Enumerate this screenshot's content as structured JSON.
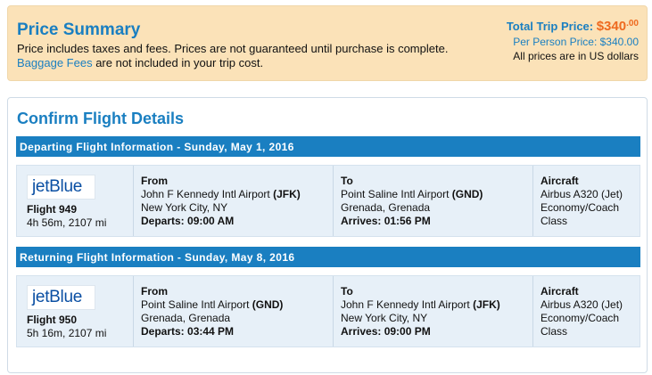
{
  "price_summary": {
    "title": "Price Summary",
    "note_line1": "Price includes taxes and fees. Prices are not guaranteed until purchase is complete.",
    "baggage_link": "Baggage Fees",
    "note_line2_rest": " are not included in your trip cost.",
    "total_label": "Total Trip Price: ",
    "total_dollars": "$340",
    "total_cents": ".00",
    "per_person": "Per Person Price: $340.00",
    "currency_note": "All prices are in US dollars"
  },
  "confirm": {
    "title": "Confirm Flight Details"
  },
  "departing": {
    "header": "Departing Flight Information - Sunday, May 1, 2016",
    "airline_logo_text": "jetBlue",
    "flight": "Flight 949",
    "duration": "4h 56m, 2107 mi",
    "from_head": "From",
    "from_airport": "John F Kennedy Intl Airport ",
    "from_code": "(JFK)",
    "from_city": "New York City, NY",
    "departs": "Departs: 09:00 AM",
    "to_head": "To",
    "to_airport": "Point Saline Intl Airport ",
    "to_code": "(GND)",
    "to_city": "Grenada, Grenada",
    "arrives": "Arrives: 01:56 PM",
    "aircraft_head": "Aircraft",
    "aircraft": "Airbus A320 (Jet)",
    "cabin1": "Economy/Coach",
    "cabin2": "Class"
  },
  "returning": {
    "header": "Returning Flight Information - Sunday, May 8, 2016",
    "airline_logo_text": "jetBlue",
    "flight": "Flight 950",
    "duration": "5h 16m, 2107 mi",
    "from_head": "From",
    "from_airport": "Point Saline Intl Airport ",
    "from_code": "(GND)",
    "from_city": "Grenada, Grenada",
    "departs": "Departs: 03:44 PM",
    "to_head": "To",
    "to_airport": "John F Kennedy Intl Airport ",
    "to_code": "(JFK)",
    "to_city": "New York City, NY",
    "arrives": "Arrives: 09:00 PM",
    "aircraft_head": "Aircraft",
    "aircraft": "Airbus A320 (Jet)",
    "cabin1": "Economy/Coach",
    "cabin2": "Class"
  },
  "colors": {
    "accent": "#1a7fc1",
    "price": "#ee6a20",
    "summary_bg": "#fbe2b8",
    "row_bg": "#e7f0f8"
  }
}
